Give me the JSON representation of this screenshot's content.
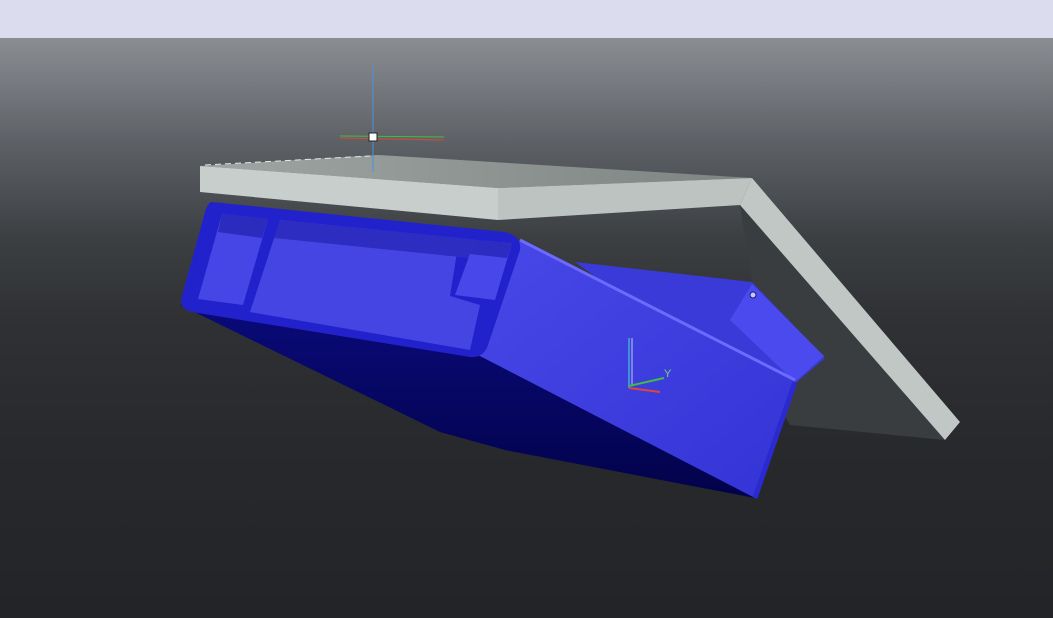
{
  "app": {
    "header_strip": ""
  },
  "viewport": {
    "background_top": "#8a8e93",
    "background_bottom": "#222427"
  },
  "model": {
    "profile_color": "#3b3be0",
    "plate_color": "#c4cbc9"
  },
  "triad": {
    "y_label": "Y"
  },
  "colors": {
    "x_axis": "#e0443a",
    "y_axis": "#3fbf3f",
    "z_axis": "#3f8fe0"
  }
}
